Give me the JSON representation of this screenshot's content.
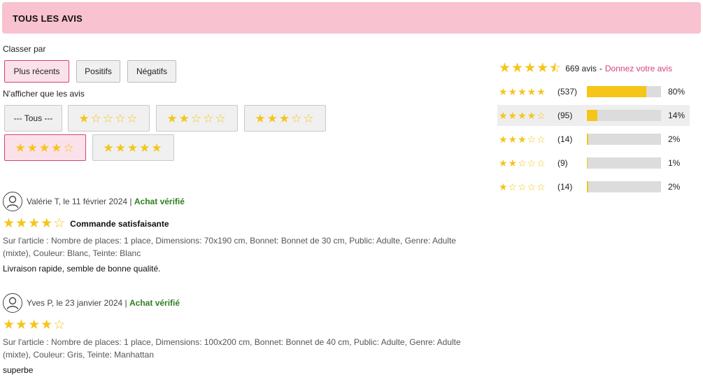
{
  "header": {
    "title": "TOUS LES AVIS"
  },
  "sort": {
    "label": "Classer par",
    "options": [
      "Plus récents",
      "Positifs",
      "Négatifs"
    ],
    "active": "Plus récents"
  },
  "filter": {
    "label": "N'afficher que les avis",
    "all_label": "--- Tous ---",
    "star_options": [
      1,
      2,
      3,
      4,
      5
    ],
    "active_stars": 4
  },
  "summary": {
    "average_rating": 4.5,
    "count_text": "669 avis",
    "separator": "-",
    "cta_text": "Donnez votre avis",
    "distribution": [
      {
        "stars": 5,
        "count_text": "(537)",
        "percent": 80,
        "percent_text": "80%"
      },
      {
        "stars": 4,
        "count_text": "(95)",
        "percent": 14,
        "percent_text": "14%"
      },
      {
        "stars": 3,
        "count_text": "(14)",
        "percent": 2,
        "percent_text": "2%"
      },
      {
        "stars": 2,
        "count_text": "(9)",
        "percent": 1,
        "percent_text": "1%"
      },
      {
        "stars": 1,
        "count_text": "(14)",
        "percent": 2,
        "percent_text": "2%"
      }
    ]
  },
  "reviews": [
    {
      "author_line": "Valérie T, le 11 février 2024 |",
      "verified": "Achat vérifié",
      "rating": 4,
      "title": "Commande satisfaisante",
      "article": "Sur l'article : Nombre de places: 1 place, Dimensions: 70x190 cm, Bonnet: Bonnet de 30 cm, Public: Adulte, Genre: Adulte (mixte), Couleur: Blanc, Teinte: Blanc",
      "body": "Livraison rapide, semble de bonne qualité."
    },
    {
      "author_line": "Yves P, le 23 janvier 2024 |",
      "verified": "Achat vérifié",
      "rating": 4,
      "title": "",
      "article": "Sur l'article : Nombre de places: 1 place, Dimensions: 100x200 cm, Bonnet: Bonnet de 40 cm, Public: Adulte, Genre: Adulte (mixte), Couleur: Gris, Teinte: Manhattan",
      "body": "superbe"
    }
  ],
  "icons": {
    "star_full": "star-filled-icon",
    "star_empty": "star-outline-icon",
    "avatar": "user-avatar-icon"
  },
  "colors": {
    "header_bg": "#f8c2d0",
    "accent": "#d6407e",
    "star": "#f5c518",
    "verified": "#2f7d1f"
  }
}
